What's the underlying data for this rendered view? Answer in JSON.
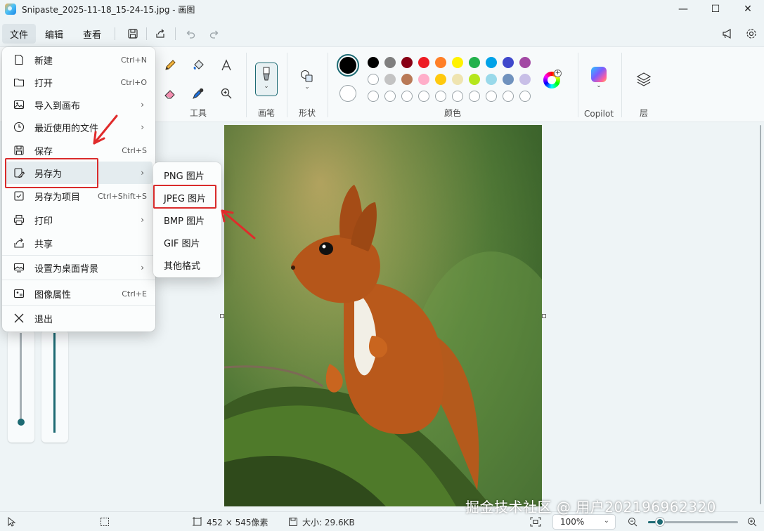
{
  "window": {
    "title": "Snipaste_2025-11-18_15-24-15.jpg - 画图",
    "minimize": "—",
    "maximize": "☐",
    "close": "✕"
  },
  "menubar": {
    "file": "文件",
    "edit": "编辑",
    "view": "查看"
  },
  "ribbon": {
    "tools_label": "工具",
    "brush_label": "画笔",
    "shapes_label": "形状",
    "colors_label": "颜色",
    "copilot_label": "Copilot",
    "layers_label": "层",
    "palette_row1": [
      "#000000",
      "#7f7f7f",
      "#880015",
      "#ed1c24",
      "#ff7f27",
      "#fff200",
      "#22b14c",
      "#00a2e8",
      "#3f48cc",
      "#a349a4"
    ],
    "palette_row2": [
      "#ffffff",
      "#c3c3c3",
      "#b97a57",
      "#ffaec9",
      "#ffc90e",
      "#efe4b0",
      "#b5e61d",
      "#99d9ea",
      "#7092be",
      "#c8bfe7"
    ],
    "palette_row3_empty": 10
  },
  "file_menu": {
    "items": [
      {
        "label": "新建",
        "shortcut": "Ctrl+N",
        "icon": "new-file-icon"
      },
      {
        "label": "打开",
        "shortcut": "Ctrl+O",
        "icon": "folder-open-icon"
      },
      {
        "label": "导入到画布",
        "shortcut": "",
        "icon": "import-image-icon",
        "submenu": true
      },
      {
        "label": "最近使用的文件",
        "shortcut": "",
        "icon": "clock-icon",
        "submenu": true
      },
      {
        "label": "保存",
        "shortcut": "Ctrl+S",
        "icon": "save-icon"
      },
      {
        "label": "另存为",
        "shortcut": "",
        "icon": "save-as-icon",
        "submenu": true,
        "highlighted": true
      },
      {
        "label": "另存为项目",
        "shortcut": "Ctrl+Shift+S",
        "icon": "save-project-icon"
      },
      {
        "label": "打印",
        "shortcut": "",
        "icon": "print-icon",
        "submenu": true
      },
      {
        "label": "共享",
        "shortcut": "",
        "icon": "share-icon"
      },
      {
        "label": "设置为桌面背景",
        "shortcut": "",
        "icon": "desktop-background-icon",
        "submenu": true
      },
      {
        "label": "图像属性",
        "shortcut": "Ctrl+E",
        "icon": "image-properties-icon"
      },
      {
        "label": "退出",
        "shortcut": "",
        "icon": "close-icon"
      }
    ]
  },
  "save_as_submenu": {
    "items": [
      "PNG 图片",
      "JPEG 图片",
      "BMP 图片",
      "GIF 图片",
      "其他格式"
    ],
    "highlighted": "JPEG 图片"
  },
  "statusbar": {
    "dimensions": "452 × 545像素",
    "size": "大小: 29.6KB",
    "zoom": "100%",
    "zoom_level": 0.13
  },
  "watermark": "掘金技术社区 @ 用户202196962320",
  "colors": {
    "accent": "#1d6a73",
    "highlight_box": "#d92b2b"
  }
}
